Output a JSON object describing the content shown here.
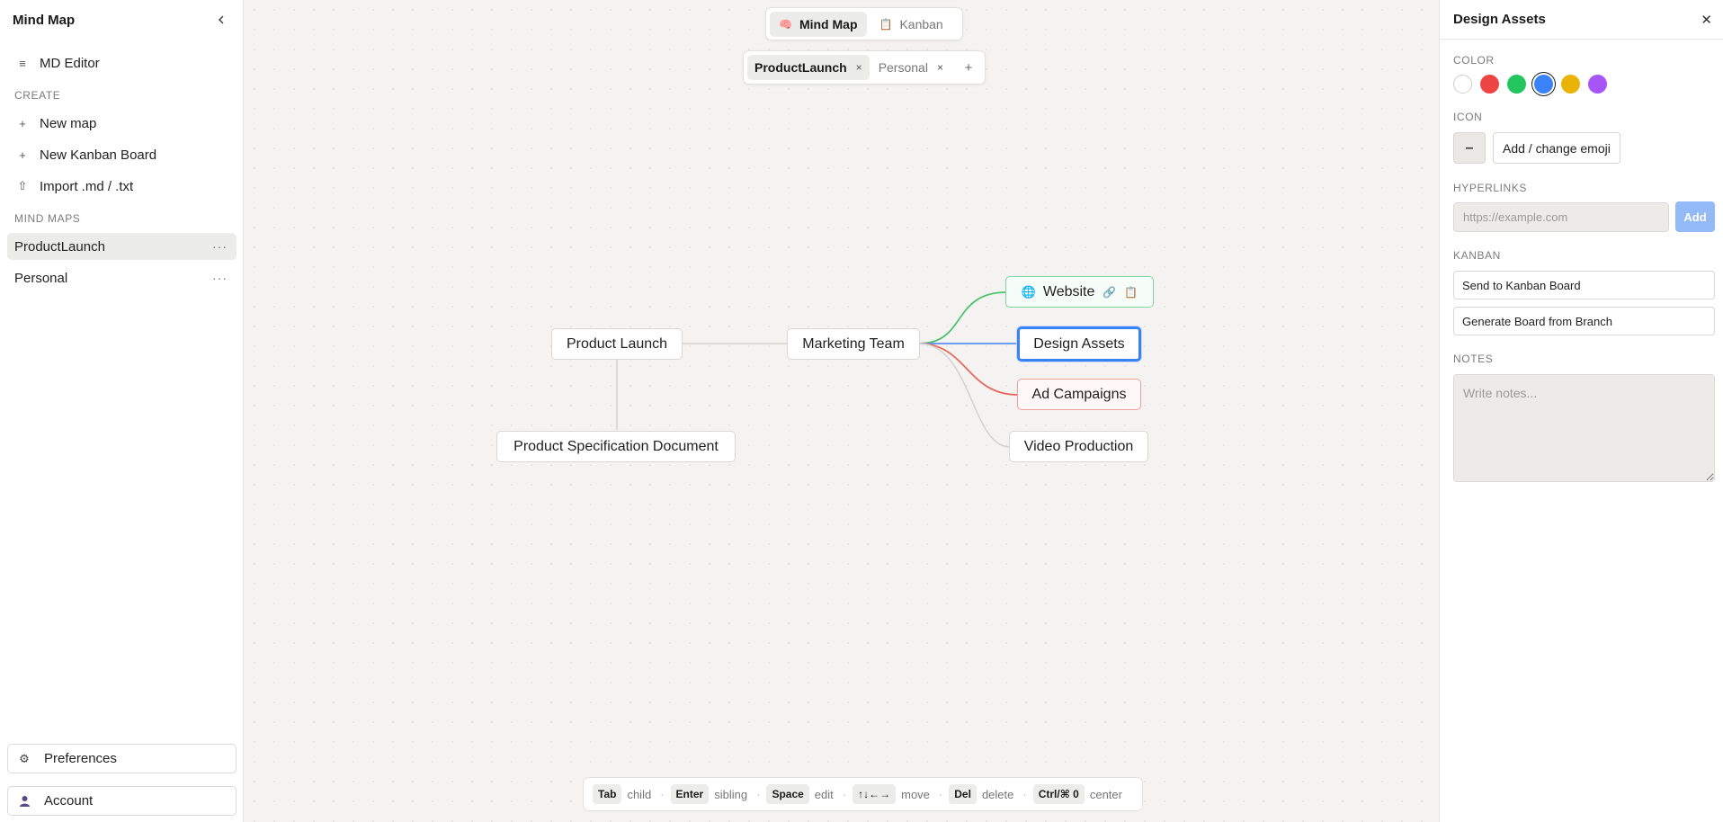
{
  "sidebar": {
    "title": "Mind Map",
    "md_editor": "MD Editor",
    "create_section": "CREATE",
    "new_map": "New map",
    "new_kanban": "New Kanban Board",
    "import": "Import .md / .txt",
    "maps_section": "MIND MAPS",
    "maps": [
      {
        "name": "ProductLaunch",
        "more": "···",
        "active": true
      },
      {
        "name": "Personal",
        "more": "···",
        "active": false
      }
    ],
    "preferences": "Preferences",
    "account": "Account"
  },
  "view_toggle": {
    "mind_map": "Mind Map",
    "kanban": "Kanban",
    "active": "Mind Map"
  },
  "tabs": [
    {
      "label": "ProductLaunch",
      "close": "×",
      "active": true
    },
    {
      "label": "Personal",
      "close": "×",
      "active": false
    }
  ],
  "tab_add": "+",
  "nodes": {
    "root": "Product Launch",
    "marketing": "Marketing Team",
    "website": "Website",
    "design": "Design Assets",
    "ads": "Ad Campaigns",
    "video": "Video Production",
    "spec": "Product Specification Document"
  },
  "shortcuts": [
    {
      "key": "Tab",
      "label": "child"
    },
    {
      "key": "Enter",
      "label": "sibling"
    },
    {
      "key": "Space",
      "label": "edit"
    },
    {
      "key": "↑↓←→",
      "label": "move"
    },
    {
      "key": "Del",
      "label": "delete"
    },
    {
      "key": "Ctrl/⌘ 0",
      "label": "center"
    }
  ],
  "panel": {
    "title": "Design Assets",
    "close": "✕",
    "color_label": "COLOR",
    "colors": [
      "#ffffff",
      "#ef4444",
      "#22c55e",
      "#3b82f6",
      "#eab308",
      "#a855f7"
    ],
    "selected_color": "#3b82f6",
    "icon_label": "ICON",
    "icon_clear": "–",
    "icon_button": "Add / change emoji",
    "hyperlinks_label": "HYPERLINKS",
    "hyperlink_placeholder": "https://example.com",
    "hyperlink_value": "",
    "add_button": "Add",
    "kanban_label": "KANBAN",
    "send_to_kanban": "Send to Kanban Board",
    "generate_board": "Generate Board from Branch",
    "notes_label": "NOTES",
    "notes_placeholder": "Write notes...",
    "notes_value": ""
  },
  "colors": {
    "edge_default": "#d4d2ce",
    "edge_green": "#4cc26e",
    "edge_blue": "#5b8ff2",
    "edge_red": "#e8685d",
    "accent": "#3b82f6"
  }
}
